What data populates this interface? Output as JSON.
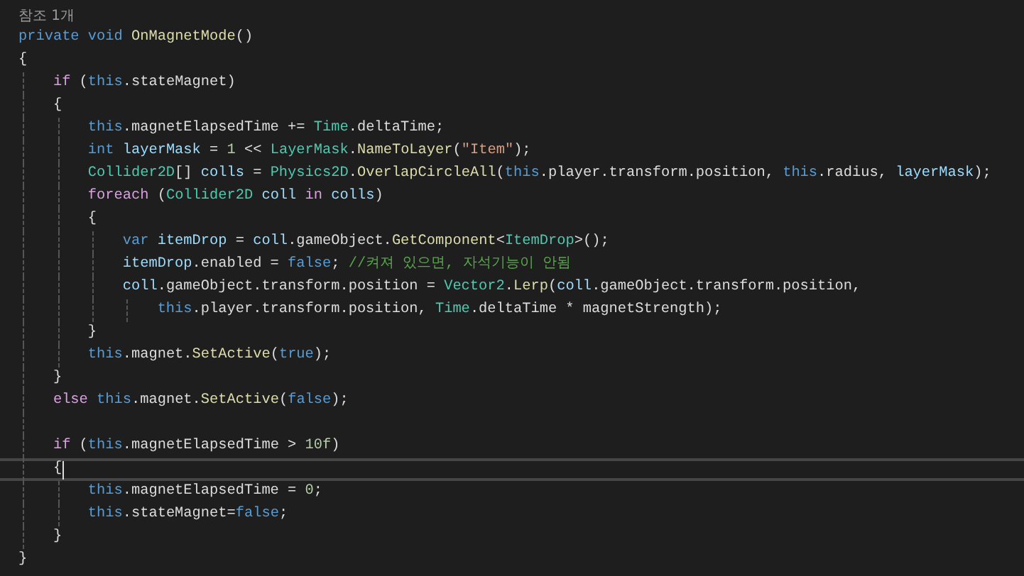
{
  "reference_lens": "참조 1개",
  "lines": [
    {
      "current": false,
      "tokens": [
        {
          "kind": "kw",
          "text": "private "
        },
        {
          "kind": "kw",
          "text": "void "
        },
        {
          "kind": "fn",
          "text": "OnMagnetMode"
        },
        {
          "kind": "p",
          "text": "()"
        }
      ]
    },
    {
      "current": false,
      "tokens": [
        {
          "kind": "p",
          "text": "{"
        }
      ]
    },
    {
      "current": false,
      "tokens": [
        {
          "kind": "ctl",
          "text": "    if "
        },
        {
          "kind": "p",
          "text": "("
        },
        {
          "kind": "kw",
          "text": "this"
        },
        {
          "kind": "p",
          "text": ".stateMagnet)"
        }
      ]
    },
    {
      "current": false,
      "tokens": [
        {
          "kind": "p",
          "text": "    {"
        }
      ]
    },
    {
      "current": false,
      "tokens": [
        {
          "kind": "kw",
          "text": "        this"
        },
        {
          "kind": "p",
          "text": ".magnetElapsedTime += "
        },
        {
          "kind": "type",
          "text": "Time"
        },
        {
          "kind": "p",
          "text": ".deltaTime;"
        }
      ]
    },
    {
      "current": false,
      "tokens": [
        {
          "kind": "kw",
          "text": "        int "
        },
        {
          "kind": "var",
          "text": "layerMask"
        },
        {
          "kind": "p",
          "text": " = "
        },
        {
          "kind": "num",
          "text": "1"
        },
        {
          "kind": "p",
          "text": " << "
        },
        {
          "kind": "type",
          "text": "LayerMask"
        },
        {
          "kind": "p",
          "text": "."
        },
        {
          "kind": "fn",
          "text": "NameToLayer"
        },
        {
          "kind": "p",
          "text": "("
        },
        {
          "kind": "str",
          "text": "\"Item\""
        },
        {
          "kind": "p",
          "text": ");"
        }
      ]
    },
    {
      "current": false,
      "tokens": [
        {
          "kind": "type",
          "text": "        Collider2D"
        },
        {
          "kind": "p",
          "text": "[] "
        },
        {
          "kind": "var",
          "text": "colls"
        },
        {
          "kind": "p",
          "text": " = "
        },
        {
          "kind": "type",
          "text": "Physics2D"
        },
        {
          "kind": "p",
          "text": "."
        },
        {
          "kind": "fn",
          "text": "OverlapCircleAll"
        },
        {
          "kind": "p",
          "text": "("
        },
        {
          "kind": "kw",
          "text": "this"
        },
        {
          "kind": "p",
          "text": ".player.transform.position, "
        },
        {
          "kind": "kw",
          "text": "this"
        },
        {
          "kind": "p",
          "text": ".radius, "
        },
        {
          "kind": "var",
          "text": "layerMask"
        },
        {
          "kind": "p",
          "text": ");"
        }
      ]
    },
    {
      "current": false,
      "tokens": [
        {
          "kind": "ctl",
          "text": "        foreach "
        },
        {
          "kind": "p",
          "text": "("
        },
        {
          "kind": "type",
          "text": "Collider2D "
        },
        {
          "kind": "var",
          "text": "coll"
        },
        {
          "kind": "ctl",
          "text": " in "
        },
        {
          "kind": "var",
          "text": "colls"
        },
        {
          "kind": "p",
          "text": ")"
        }
      ]
    },
    {
      "current": false,
      "tokens": [
        {
          "kind": "p",
          "text": "        {"
        }
      ]
    },
    {
      "current": false,
      "tokens": [
        {
          "kind": "kw",
          "text": "            var "
        },
        {
          "kind": "var",
          "text": "itemDrop"
        },
        {
          "kind": "p",
          "text": " = "
        },
        {
          "kind": "var",
          "text": "coll"
        },
        {
          "kind": "p",
          "text": ".gameObject."
        },
        {
          "kind": "fn",
          "text": "GetComponent"
        },
        {
          "kind": "p",
          "text": "<"
        },
        {
          "kind": "type",
          "text": "ItemDrop"
        },
        {
          "kind": "p",
          "text": ">();"
        }
      ]
    },
    {
      "current": false,
      "tokens": [
        {
          "kind": "var",
          "text": "            itemDrop"
        },
        {
          "kind": "p",
          "text": ".enabled = "
        },
        {
          "kind": "kw",
          "text": "false"
        },
        {
          "kind": "p",
          "text": "; "
        },
        {
          "kind": "cmt",
          "text": "//켜져 있으면, 자석기능이 안됨"
        }
      ]
    },
    {
      "current": false,
      "tokens": [
        {
          "kind": "var",
          "text": "            coll"
        },
        {
          "kind": "p",
          "text": ".gameObject.transform.position = "
        },
        {
          "kind": "type",
          "text": "Vector2"
        },
        {
          "kind": "p",
          "text": "."
        },
        {
          "kind": "fn",
          "text": "Lerp"
        },
        {
          "kind": "p",
          "text": "("
        },
        {
          "kind": "var",
          "text": "coll"
        },
        {
          "kind": "p",
          "text": ".gameObject.transform.position,"
        }
      ]
    },
    {
      "current": false,
      "tokens": [
        {
          "kind": "kw",
          "text": "                this"
        },
        {
          "kind": "p",
          "text": ".player.transform.position, "
        },
        {
          "kind": "type",
          "text": "Time"
        },
        {
          "kind": "p",
          "text": ".deltaTime * magnetStrength);"
        }
      ]
    },
    {
      "current": false,
      "tokens": [
        {
          "kind": "p",
          "text": "        }"
        }
      ]
    },
    {
      "current": false,
      "tokens": [
        {
          "kind": "kw",
          "text": "        this"
        },
        {
          "kind": "p",
          "text": ".magnet."
        },
        {
          "kind": "fn",
          "text": "SetActive"
        },
        {
          "kind": "p",
          "text": "("
        },
        {
          "kind": "kw",
          "text": "true"
        },
        {
          "kind": "p",
          "text": ");"
        }
      ]
    },
    {
      "current": false,
      "tokens": [
        {
          "kind": "p",
          "text": "    }"
        }
      ]
    },
    {
      "current": false,
      "tokens": [
        {
          "kind": "ctl",
          "text": "    else "
        },
        {
          "kind": "kw",
          "text": "this"
        },
        {
          "kind": "p",
          "text": ".magnet."
        },
        {
          "kind": "fn",
          "text": "SetActive"
        },
        {
          "kind": "p",
          "text": "("
        },
        {
          "kind": "kw",
          "text": "false"
        },
        {
          "kind": "p",
          "text": ");"
        }
      ]
    },
    {
      "current": false
    },
    {
      "current": false,
      "tokens": [
        {
          "kind": "ctl",
          "text": "    if "
        },
        {
          "kind": "p",
          "text": "("
        },
        {
          "kind": "kw",
          "text": "this"
        },
        {
          "kind": "p",
          "text": ".magnetElapsedTime > "
        },
        {
          "kind": "num",
          "text": "10f"
        },
        {
          "kind": "p",
          "text": ")"
        }
      ]
    },
    {
      "current": true,
      "tokens": [
        {
          "kind": "p",
          "text": "    {"
        }
      ]
    },
    {
      "current": false,
      "tokens": [
        {
          "kind": "kw",
          "text": "        this"
        },
        {
          "kind": "p",
          "text": ".magnetElapsedTime = "
        },
        {
          "kind": "num",
          "text": "0"
        },
        {
          "kind": "p",
          "text": ";"
        }
      ]
    },
    {
      "current": false,
      "tokens": [
        {
          "kind": "kw",
          "text": "        this"
        },
        {
          "kind": "p",
          "text": ".stateMagnet="
        },
        {
          "kind": "kw",
          "text": "false"
        },
        {
          "kind": "p",
          "text": ";"
        }
      ]
    },
    {
      "current": false,
      "tokens": [
        {
          "kind": "p",
          "text": "    }"
        }
      ]
    },
    {
      "current": false,
      "tokens": [
        {
          "kind": "p",
          "text": "}"
        }
      ]
    }
  ]
}
